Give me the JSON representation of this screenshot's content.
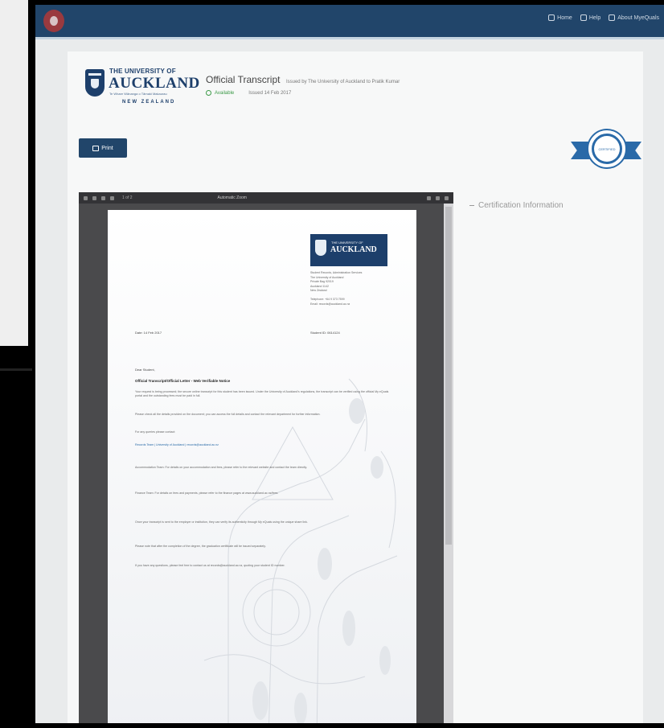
{
  "topbar": {
    "nav": [
      {
        "label": "Home",
        "icon": "home-icon"
      },
      {
        "label": "Help",
        "icon": "help-icon"
      },
      {
        "label": "About MyeQuals",
        "icon": "info-icon"
      }
    ]
  },
  "logo": {
    "line1": "THE UNIVERSITY OF",
    "line2": "AUCKLAND",
    "line3": "Te Whare Wānanga o Tāmaki Makaurau",
    "line4": "NEW ZEALAND"
  },
  "document": {
    "title": "Official Transcript",
    "issued_by": "Issued by The University of Auckland to Pratik Kumar",
    "status": "Available",
    "issued_date": "Issued 14 Feb 2017"
  },
  "actions": {
    "print_label": "Print"
  },
  "badge": {
    "label": "CERTIFIED"
  },
  "viewer": {
    "page_info": "1 of 2",
    "zoom": "Automatic Zoom"
  },
  "letter": {
    "logo_small": "THE UNIVERSITY OF",
    "logo_big": "AUCKLAND",
    "address": "Student Records, Administration Services\nThe University of Auckland\nPrivate Bag 92019\nAuckland 1142\nNew Zealand\n\nTelephone: +64 9 373 7599\nEmail: records@auckland.ac.nz",
    "date": "Date: 14 Feb 2017",
    "student_id": "Student ID: 0614124",
    "greeting": "Dear Student,",
    "subject": "Official Transcript/Official Letter - Web Verifiable Notice",
    "p1": "Your request is being processed; the secure online transcript for this student has been issued. Under the University of Auckland's regulations, the transcript can be verified using the official My eQuals portal and the outstanding fees must be paid in full.",
    "p2": "Please check all the details provided on the document; you can access the full details and contact the relevant department for further information.",
    "p3": "For any queries please contact:",
    "p4": "Records Team | University of Auckland | records@auckland.ac.nz",
    "p5": "Accommodation Team: For details on your accommodation and fees, please refer to the relevant website and contact the team directly.",
    "p6": "Finance Team: For details on fees and payments, please refer to the finance pages at www.auckland.ac.nz/fees.",
    "p7": "Once your transcript is sent to the employer or institution, they can verify its authenticity through My eQuals using the unique share link.",
    "p8": "Please note that after the completion of the degree, the graduation certificate will be issued separately.",
    "p9": "If you have any questions, please feel free to contact us at records@auckland.ac.nz, quoting your student ID number."
  },
  "sidebar": {
    "cert_info_label": "Certification Information"
  }
}
